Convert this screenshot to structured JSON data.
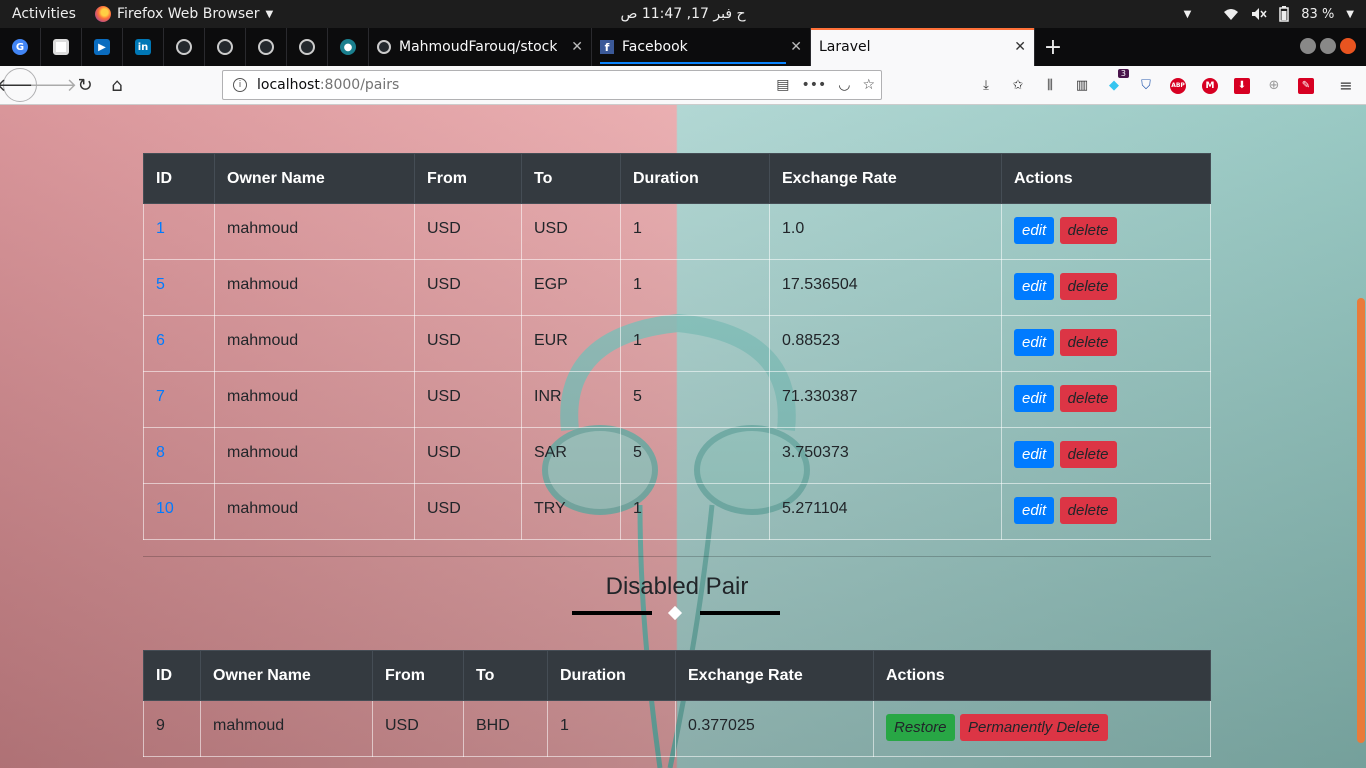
{
  "os": {
    "activities": "Activities",
    "app_name": "Firefox Web Browser",
    "clock": "ح فبر 17, 11:47 ص",
    "battery": "83 %"
  },
  "tabs": {
    "pinned": [
      "google-icon",
      "white-page-icon",
      "video-icon",
      "linkedin-icon",
      "github-icon",
      "github-icon",
      "github-icon",
      "github-icon",
      "extension-icon"
    ],
    "items": [
      {
        "label": "MahmoudFarouq/stock",
        "icon": "github-icon"
      },
      {
        "label": "Facebook",
        "icon": "facebook-icon"
      },
      {
        "label": "Laravel",
        "icon": ""
      }
    ]
  },
  "nav": {
    "url_host": "localhost",
    "url_path": ":8000/pairs"
  },
  "toolbar": {
    "slack_count": "3"
  },
  "active_table": {
    "headers": [
      "ID",
      "Owner Name",
      "From",
      "To",
      "Duration",
      "Exchange Rate",
      "Actions"
    ],
    "rows": [
      {
        "id": "1",
        "owner": "mahmoud",
        "from": "USD",
        "to": "USD",
        "duration": "1",
        "rate": "1.0"
      },
      {
        "id": "5",
        "owner": "mahmoud",
        "from": "USD",
        "to": "EGP",
        "duration": "1",
        "rate": "17.536504"
      },
      {
        "id": "6",
        "owner": "mahmoud",
        "from": "USD",
        "to": "EUR",
        "duration": "1",
        "rate": "0.88523"
      },
      {
        "id": "7",
        "owner": "mahmoud",
        "from": "USD",
        "to": "INR",
        "duration": "5",
        "rate": "71.330387"
      },
      {
        "id": "8",
        "owner": "mahmoud",
        "from": "USD",
        "to": "SAR",
        "duration": "5",
        "rate": "3.750373"
      },
      {
        "id": "10",
        "owner": "mahmoud",
        "from": "USD",
        "to": "TRY",
        "duration": "1",
        "rate": "5.271104"
      }
    ],
    "edit_label": "edit",
    "delete_label": "delete"
  },
  "disabled_section": {
    "title": "Disabled Pair"
  },
  "disabled_table": {
    "headers": [
      "ID",
      "Owner Name",
      "From",
      "To",
      "Duration",
      "Exchange Rate",
      "Actions"
    ],
    "rows": [
      {
        "id": "9",
        "owner": "mahmoud",
        "from": "USD",
        "to": "BHD",
        "duration": "1",
        "rate": "0.377025"
      }
    ],
    "restore_label": "Restore",
    "perm_delete_label": "Permanently Delete"
  },
  "colors": {
    "accent_blue": "#007bff",
    "danger": "#dc3545",
    "success": "#28a745",
    "table_header": "#343a40",
    "tab_highlight": "#ff7139"
  }
}
